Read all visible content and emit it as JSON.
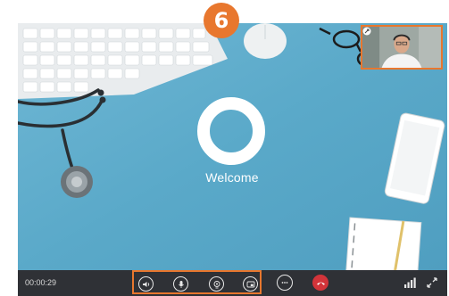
{
  "colors": {
    "accent": "#e8772e",
    "background": "#5aa9c9",
    "callbar": "#2f3136",
    "hangup": "#d3343a"
  },
  "step_badge": "6",
  "welcome": {
    "label": "Welcome"
  },
  "call": {
    "timer": "00:00:29"
  },
  "icons": {
    "speaker": "speaker-icon",
    "microphone": "microphone-icon",
    "camera": "camera-icon",
    "screen_share": "screen-share-icon",
    "more": "more-options-icon",
    "hangup": "hang-up-icon",
    "signal": "signal-strength-icon",
    "fullscreen": "fullscreen-icon",
    "pip_expand": "expand-icon"
  }
}
